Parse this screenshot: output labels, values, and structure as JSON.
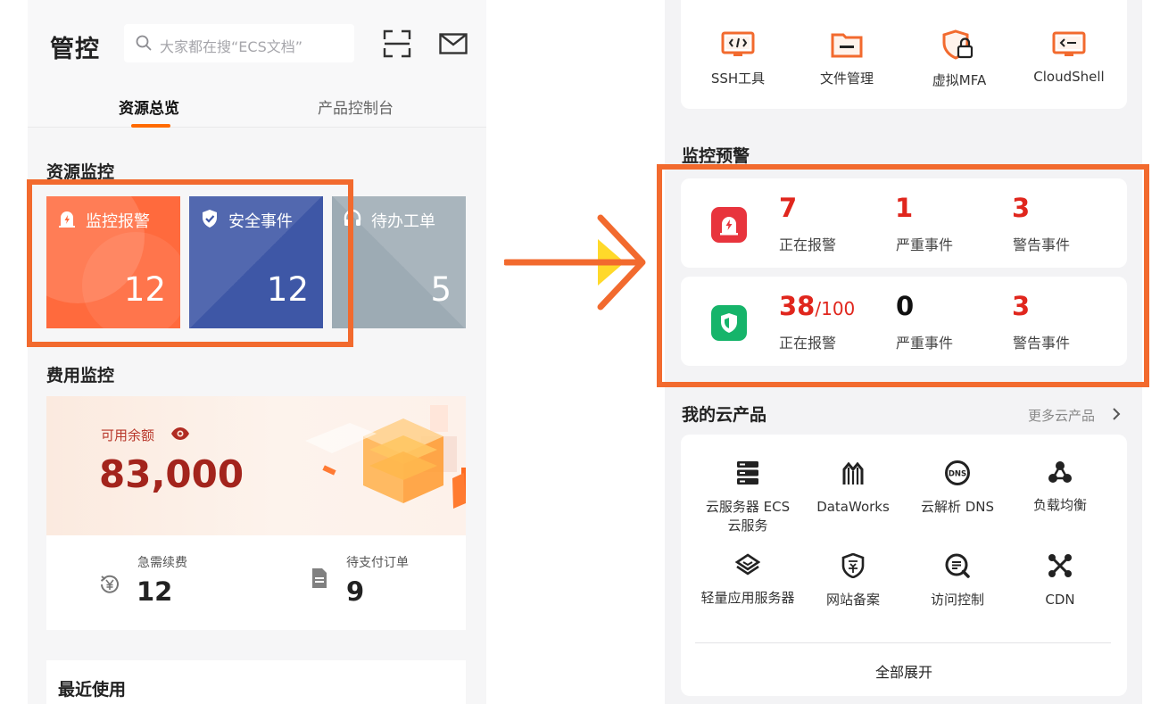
{
  "left": {
    "title": "管控",
    "search": {
      "placeholder": "大家都在搜“ECS文档”"
    },
    "tabs": [
      {
        "label": "资源总览"
      },
      {
        "label": "产品控制台"
      }
    ],
    "resource_monitor": {
      "title": "资源监控",
      "tiles": [
        {
          "label": "监控报警",
          "count": "12",
          "color": "#ff6633"
        },
        {
          "label": "安全事件",
          "count": "12",
          "color": "#3c55a5"
        },
        {
          "label": "待办工单",
          "count": "5",
          "color": "#9aa8b2"
        }
      ]
    },
    "cost_monitor": {
      "title": "费用监控",
      "balance_label": "可用余额",
      "balance_value": "83,000",
      "urgent_renew_label": "急需续费",
      "urgent_renew_value": "12",
      "pending_orders_label": "待支付订单",
      "pending_orders_value": "9"
    },
    "recent": {
      "title": "最近使用"
    }
  },
  "right": {
    "tools": [
      {
        "label": "SSH工具",
        "icon": "terminal-code-icon"
      },
      {
        "label": "文件管理",
        "icon": "folder-icon"
      },
      {
        "label": "虚拟MFA",
        "icon": "shield-lock-icon"
      },
      {
        "label": "CloudShell",
        "icon": "cloudshell-icon"
      }
    ],
    "monitor_alert": {
      "title": "监控预警",
      "rows": [
        {
          "icon": "alarm-icon",
          "icon_color": "#e8343d",
          "metrics": [
            {
              "value": "7",
              "suffix": "",
              "label": "正在报警",
              "color": "#e0261d"
            },
            {
              "value": "1",
              "suffix": "",
              "label": "严重事件",
              "color": "#e0261d"
            },
            {
              "value": "3",
              "suffix": "",
              "label": "警告事件",
              "color": "#e0261d"
            }
          ]
        },
        {
          "icon": "shield-icon",
          "icon_color": "#16b46a",
          "metrics": [
            {
              "value": "38",
              "suffix": "/100",
              "label": "正在报警",
              "color": "#e0261d"
            },
            {
              "value": "0",
              "suffix": "",
              "label": "严重事件",
              "color": "#111111"
            },
            {
              "value": "3",
              "suffix": "",
              "label": "警告事件",
              "color": "#e0261d"
            }
          ]
        }
      ]
    },
    "my_products": {
      "title": "我的云产品",
      "more": "更多云产品",
      "items": [
        {
          "line1": "云服务器 ECS",
          "line2": "云服务",
          "icon": "server-icon"
        },
        {
          "line1": "DataWorks",
          "line2": "",
          "icon": "dataworks-icon"
        },
        {
          "line1": "云解析 DNS",
          "line2": "",
          "icon": "dns-icon"
        },
        {
          "line1": "负载均衡",
          "line2": "",
          "icon": "load-balancer-icon"
        },
        {
          "line1": "轻量应用服务器",
          "line2": "",
          "icon": "lightweight-server-icon"
        },
        {
          "line1": "网站备案",
          "line2": "",
          "icon": "filing-icon"
        },
        {
          "line1": "访问控制",
          "line2": "",
          "icon": "access-control-icon"
        },
        {
          "line1": "CDN",
          "line2": "",
          "icon": "cdn-icon"
        }
      ],
      "expand": "全部展开"
    }
  },
  "accent": "#ff6a00",
  "highlight_color": "#f26a2e"
}
